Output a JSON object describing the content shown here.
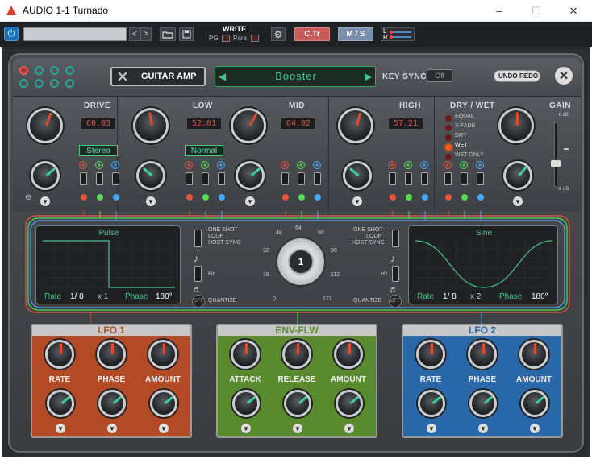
{
  "window": {
    "title": "AUDIO 1-1 Turnado",
    "minimize": "–",
    "maximize": "☐",
    "close": "✕"
  },
  "host": {
    "write_label": "WRITE",
    "pg_label": "PG",
    "para_label": "Para",
    "ctr_label": "C.Tr",
    "ms_label": "M / S",
    "l_label": "L",
    "r_label": "R",
    "prev": "<",
    "next": ">"
  },
  "header": {
    "effect_name": "GUITAR AMP",
    "preset_name": "Booster",
    "key_sync_label": "KEY SYNC",
    "key_sync_value": "Off",
    "undo_label": "UNDO",
    "redo_label": "REDO"
  },
  "sections": [
    {
      "label": "DRIVE",
      "value": "60.03",
      "mode": "Stereo"
    },
    {
      "label": "LOW",
      "value": "52.01",
      "mode": "Normal"
    },
    {
      "label": "MID",
      "value": "64.02"
    },
    {
      "label": "HIGH",
      "value": "57.21"
    }
  ],
  "drywet": {
    "label": "DRY / WET",
    "options": [
      "EQUAL",
      "X-FADE",
      "DRY",
      "WET",
      "WET ONLY"
    ],
    "selected": "WET"
  },
  "gain": {
    "label": "GAIN",
    "max": "+6 dB",
    "min": "-6 dB"
  },
  "lfo_left": {
    "shape": "Pulse",
    "rate_label": "Rate",
    "rate": "1/ 8",
    "mult": "x 1",
    "phase_label": "Phase",
    "phase": "180°",
    "modes": [
      "ONE SHOT",
      "LOOP",
      "HOST SYNC"
    ],
    "hz_label": "Hz",
    "quantize_label": "QUANTIZE",
    "off_label": "OFF"
  },
  "lfo_right": {
    "shape": "Sine",
    "rate_label": "Rate",
    "rate": "1/ 8",
    "mult": "x 2",
    "phase_label": "Phase",
    "phase": "180°",
    "modes": [
      "ONE SHOT",
      "LOOP",
      "HOST SYNC"
    ],
    "hz_label": "Hz",
    "quantize_label": "QUANTIZE",
    "off_label": "OFF"
  },
  "step_dial": {
    "value": "1",
    "scale": [
      "64",
      "48",
      "80",
      "32",
      "96",
      "16",
      "112",
      "0",
      "127"
    ]
  },
  "modules": [
    {
      "title": "LFO 1",
      "color": "#b24a25",
      "labels": [
        "RATE",
        "PHASE",
        "AMOUNT"
      ]
    },
    {
      "title": "ENV-FLW",
      "color": "#5a8a2e",
      "labels": [
        "ATTACK",
        "RELEASE",
        "AMOUNT"
      ]
    },
    {
      "title": "LFO 2",
      "color": "#2868a8",
      "labels": [
        "RATE",
        "PHASE",
        "AMOUNT"
      ]
    }
  ],
  "colors": {
    "accent_red": "#e8543a",
    "accent_green": "#3cd29a",
    "lfo1": "#b24a25",
    "env": "#5a8a2e",
    "lfo2": "#2868a8",
    "preset_green": "#46c68a"
  }
}
